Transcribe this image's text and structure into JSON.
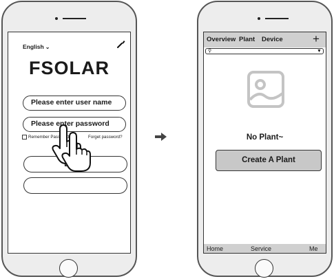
{
  "login_screen": {
    "language": "English",
    "brand": "FSOLAR",
    "username_placeholder": "Please enter user name",
    "password_placeholder": "Please enter password",
    "remember_label": "Remember Password",
    "forget_label": "Forget password?",
    "login_label": "Login"
  },
  "plant_screen": {
    "tabs": [
      "Overview",
      "Plant",
      "Device"
    ],
    "empty_message": "No Plant~",
    "create_button": "Create A Plant",
    "nav": [
      "Home",
      "Service",
      "Me"
    ]
  }
}
